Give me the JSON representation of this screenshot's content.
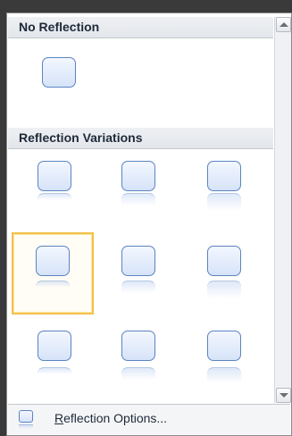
{
  "gallery": {
    "section_no_reflection": "No Reflection",
    "section_variations": "Reflection Variations",
    "no_reflection_items": [
      {
        "name": "none"
      }
    ],
    "variation_items": [
      {
        "name": "tight-reflection-touching",
        "selected": false
      },
      {
        "name": "half-reflection-touching",
        "selected": false
      },
      {
        "name": "full-reflection-touching",
        "selected": false
      },
      {
        "name": "tight-reflection-4pt-offset",
        "selected": true
      },
      {
        "name": "half-reflection-4pt-offset",
        "selected": false
      },
      {
        "name": "full-reflection-4pt-offset",
        "selected": false
      },
      {
        "name": "tight-reflection-8pt-offset",
        "selected": false
      },
      {
        "name": "half-reflection-8pt-offset",
        "selected": false
      },
      {
        "name": "full-reflection-8pt-offset",
        "selected": false
      }
    ]
  },
  "footer": {
    "options_accel": "R",
    "options_rest": "eflection Options...",
    "options_icon": "reflection-options-icon"
  },
  "colors": {
    "shape_border": "#5b84c2",
    "selected_border": "#f2c14a",
    "header_bg": "#e8eaee"
  }
}
